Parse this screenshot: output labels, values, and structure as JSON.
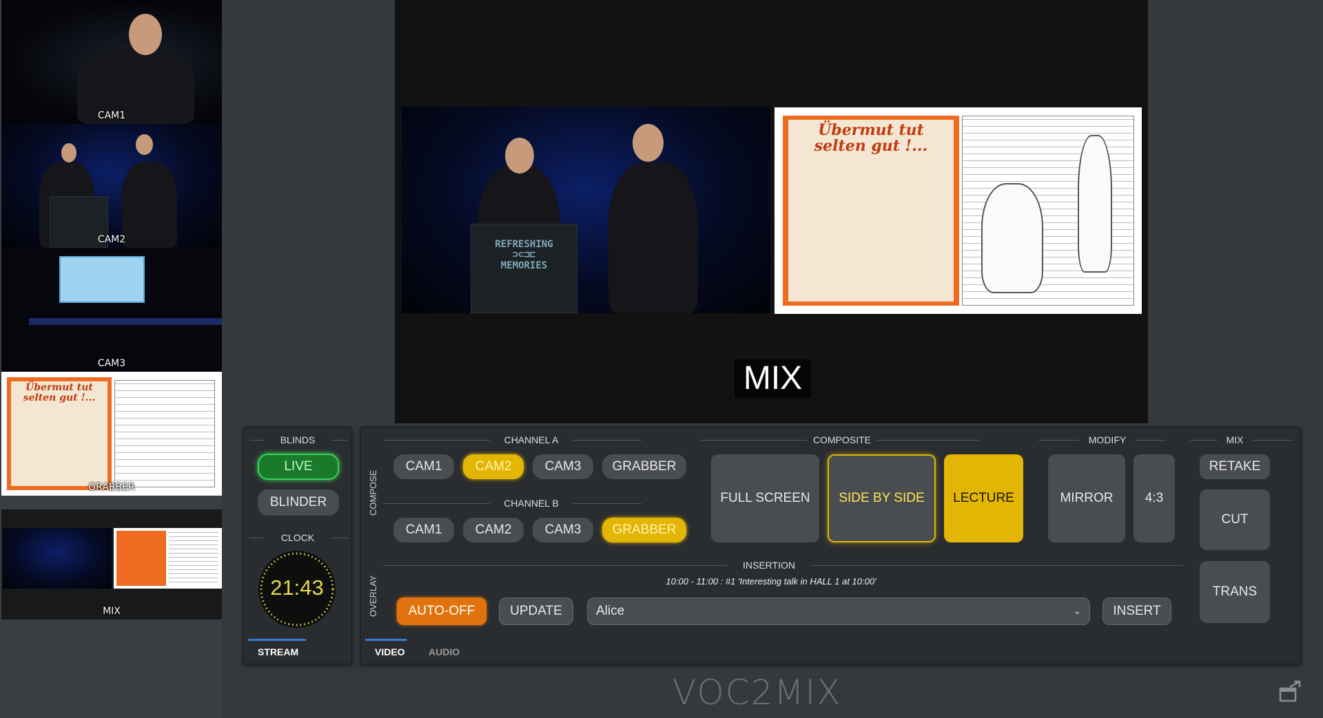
{
  "sidebar": {
    "sources": [
      {
        "label": "CAM1"
      },
      {
        "label": "CAM2"
      },
      {
        "label": "CAM3"
      },
      {
        "label": "GRABBER"
      },
      {
        "label": "MIX"
      }
    ]
  },
  "preview": {
    "overlay_label": "MIX",
    "lectern_text": "REFRESHING\n⊃⊂⊐⊏\nMEMORIES",
    "book_title": "Übermut tut selten gut !..."
  },
  "blinds": {
    "title": "BLINDS",
    "live_label": "LIVE",
    "blinder_label": "BLINDER"
  },
  "clock": {
    "title": "CLOCK",
    "time": "21:43"
  },
  "stream_tab": "STREAM",
  "compose": {
    "side_label": "COMPOSE",
    "channel_a": {
      "title": "CHANNEL A",
      "buttons": [
        "CAM1",
        "CAM2",
        "CAM3",
        "GRABBER"
      ],
      "active": "CAM2"
    },
    "channel_b": {
      "title": "CHANNEL B",
      "buttons": [
        "CAM1",
        "CAM2",
        "CAM3",
        "GRABBER"
      ],
      "active": "GRABBER"
    },
    "composite": {
      "title": "COMPOSITE",
      "buttons": [
        "FULL SCREEN",
        "SIDE BY SIDE",
        "LECTURE"
      ]
    },
    "modify": {
      "title": "MODIFY",
      "buttons": [
        "MIRROR",
        "4:3"
      ]
    },
    "mix": {
      "title": "MIX",
      "buttons": [
        "RETAKE",
        "CUT",
        "TRANS"
      ]
    }
  },
  "overlay": {
    "side_label": "OVERLAY",
    "title": "INSERTION",
    "insertion_text": "10:00 - 11:00 : #1  'Interesting talk in HALL 1 at 10:00'",
    "auto_off_label": "AUTO-OFF",
    "update_label": "UPDATE",
    "select_value": "Alice",
    "insert_label": "INSERT"
  },
  "tabs": [
    "VIDEO",
    "AUDIO"
  ],
  "footer": {
    "logo_text": "VOC2MIX"
  },
  "colors": {
    "accent_yellow": "#e3b505",
    "live_green": "#3ad15a",
    "auto_off_orange": "#e0730d",
    "tab_blue": "#3a7bd5"
  }
}
